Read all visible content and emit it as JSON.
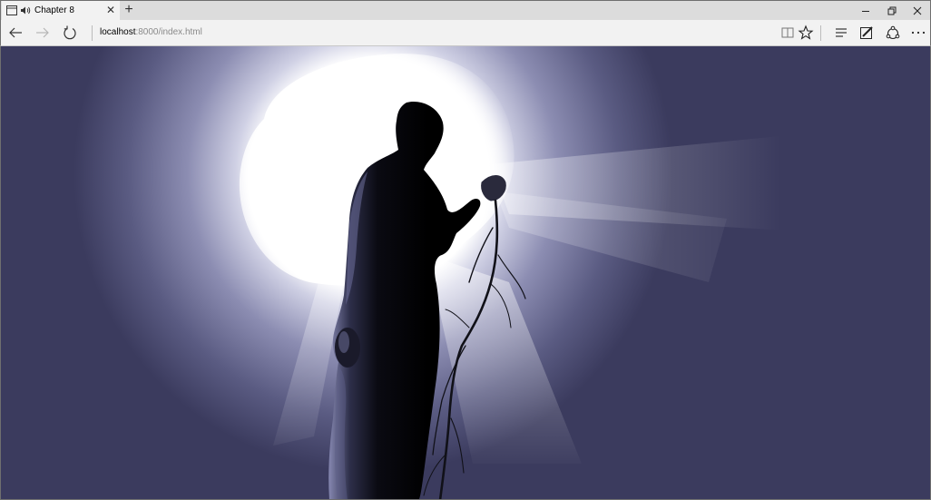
{
  "window": {
    "tab_title": "Chapter 8",
    "new_tab_symbol": "+",
    "close_tab_symbol": "✕"
  },
  "icons": {
    "tab_page": "page-icon",
    "tab_audio": "speaker-icon",
    "back": "arrow-left-icon",
    "forward": "arrow-right-icon",
    "refresh": "refresh-icon",
    "reading_view": "book-icon",
    "favorite": "star-icon",
    "hub": "hub-icon",
    "web_note": "pen-icon",
    "share": "share-icon",
    "more": "ellipsis-icon",
    "minimize": "minimize-icon",
    "restore": "restore-icon",
    "close": "close-icon"
  },
  "address_bar": {
    "host": "localhost",
    "path": ":8000/index.html"
  },
  "scene": {
    "background_color": "#3b3b5e",
    "light_color": "#ffffff",
    "silhouette_color": "#0a0a12",
    "statue_highlight": "#7a7ca8"
  }
}
